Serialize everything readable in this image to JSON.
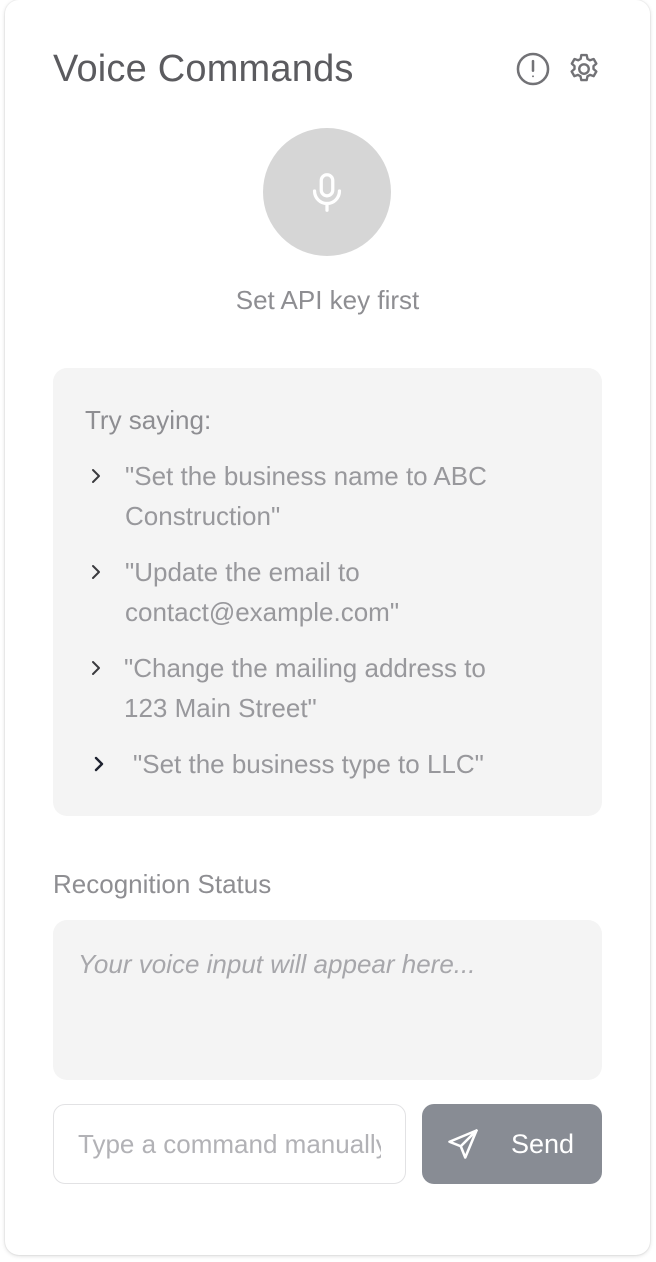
{
  "header": {
    "title": "Voice Commands",
    "info_icon": "info-circle-icon",
    "settings_icon": "gear-icon"
  },
  "mic": {
    "icon": "microphone-icon",
    "status_note": "Set API key first"
  },
  "examples": {
    "title": "Try saying:",
    "items": [
      {
        "line1": "\"Set the business name to ABC",
        "line2": "Construction\""
      },
      {
        "line1": "\"Update the email to",
        "line2": "contact@example.com\""
      },
      {
        "line1": "\"Change the mailing address to",
        "line2": "123 Main Street\""
      },
      {
        "line1": "\"Set the business type to LLC\""
      }
    ]
  },
  "recognition": {
    "label": "Recognition Status",
    "placeholder_text": "Your voice input will appear here..."
  },
  "command": {
    "input_value": "",
    "input_placeholder": "Type a command manually...",
    "send_label": "Send",
    "send_icon": "paper-plane-icon"
  },
  "colors": {
    "send_button": "#888c94",
    "mic_button": "#d6d6d6",
    "panel_fill": "#f4f4f4",
    "text_muted": "#8e8e92"
  }
}
